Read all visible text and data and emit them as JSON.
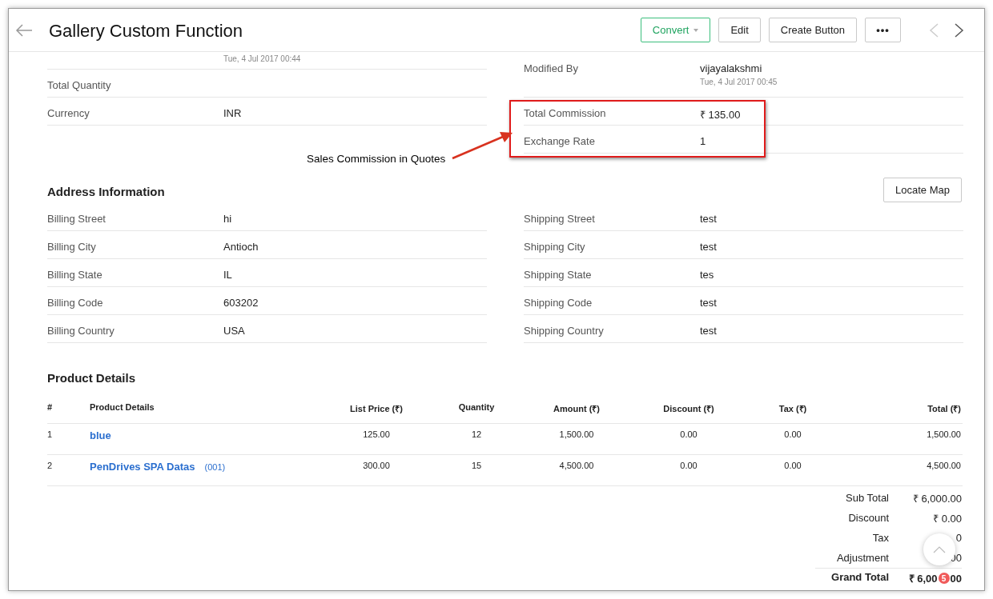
{
  "header": {
    "title": "Gallery Custom Function",
    "buttons": [
      {
        "label": "Convert",
        "kind": "dropdown"
      },
      {
        "label": "Edit",
        "kind": "plain"
      },
      {
        "label": "Create Button",
        "kind": "plain"
      },
      {
        "label": "•••",
        "kind": "more"
      }
    ],
    "previous": {
      "disabled": true
    },
    "next": {
      "disabled": false
    }
  },
  "summary": {
    "left": [
      {
        "sub": "Tue, 4 Jul 2017 00:44"
      },
      {
        "label": "Total Quantity"
      },
      {
        "label": "Currency",
        "value": "INR"
      }
    ],
    "right": [
      {
        "label": "Modified By",
        "value": "vijayalakshmi",
        "sub": "Tue, 4 Jul 2017 00:45"
      },
      {
        "label": "Total Commission",
        "value": "₹ 135.00",
        "highlighted": true
      },
      {
        "label": "Exchange Rate",
        "value": "1",
        "highlighted": true
      }
    ],
    "annotation": "Sales Commission in Quotes"
  },
  "address": {
    "title": "Address Information",
    "action": "Locate Map",
    "left": [
      {
        "label": "Billing Street",
        "value": "hi"
      },
      {
        "label": "Billing City",
        "value": "Antioch"
      },
      {
        "label": "Billing State",
        "value": "IL"
      },
      {
        "label": "Billing Code",
        "value": "603202"
      },
      {
        "label": "Billing Country",
        "value": "USA"
      }
    ],
    "right": [
      {
        "label": "Shipping Street",
        "value": "test"
      },
      {
        "label": "Shipping City",
        "value": "test"
      },
      {
        "label": "Shipping State",
        "value": "tes"
      },
      {
        "label": "Shipping Code",
        "value": "test"
      },
      {
        "label": "Shipping Country",
        "value": "test"
      }
    ]
  },
  "products": {
    "title": "Product Details",
    "columns": [
      "#",
      "Product Details",
      "List Price (₹)",
      "Quantity",
      "Amount (₹)",
      "Discount (₹)",
      "Tax (₹)",
      "Total (₹)"
    ],
    "rows": [
      {
        "number": "1",
        "product": "blue",
        "list_price": "125.00",
        "quantity": "12",
        "amount": "1,500.00",
        "discount": "0.00",
        "tax": "0.00",
        "total": "1,500.00"
      },
      {
        "number": "2",
        "product": "PenDrives SPA Datas",
        "code": "(001)",
        "list_price": "300.00",
        "quantity": "15",
        "amount": "4,500.00",
        "discount": "0.00",
        "tax": "0.00",
        "total": "4,500.00"
      }
    ]
  },
  "totals": [
    {
      "label": "Sub Total",
      "value": "₹ 6,000.00",
      "kind": "normal"
    },
    {
      "label": "Discount",
      "value": "₹ 0.00",
      "kind": "normal"
    },
    {
      "label": "Tax",
      "value": "0",
      "kind": "normal"
    },
    {
      "label": "Adjustment",
      "value": "00",
      "kind": "normal"
    },
    {
      "label": "Grand Total",
      "value": "₹ 6,00",
      "value_tail": "00",
      "badge": "5",
      "kind": "grand"
    }
  ]
}
